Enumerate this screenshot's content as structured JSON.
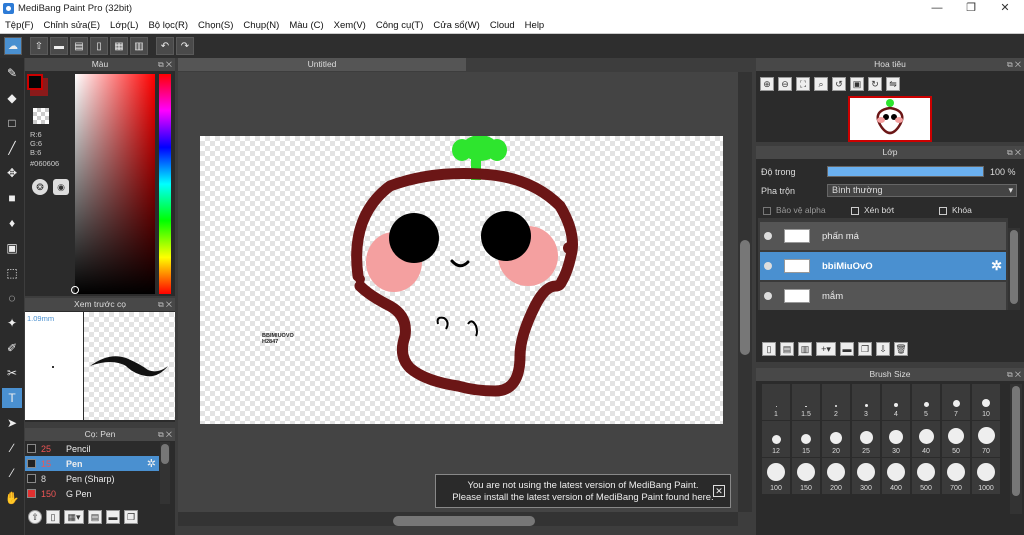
{
  "window": {
    "title": "MediBang Paint Pro (32bit)"
  },
  "menu": [
    "Tệp(F)",
    "Chỉnh sửa(E)",
    "Lớp(L)",
    "Bộ lọc(R)",
    "Chọn(S)",
    "Chụp(N)",
    "Màu (C)",
    "Xem(V)",
    "Công cụ(T)",
    "Cửa sổ(W)",
    "Cloud",
    "Help"
  ],
  "color_panel": {
    "title": "Màu",
    "r": "R:6",
    "g": "G:6",
    "b": "B:6",
    "hex": "#060606",
    "fg": "#060606",
    "bg": "#8b1a1a"
  },
  "preview_panel": {
    "title": "Xem trước cọ",
    "size": "1.09mm"
  },
  "brush_panel": {
    "title": "Cọ: Pen",
    "items": [
      {
        "size": "25",
        "name": "Pencil",
        "color": "#222222"
      },
      {
        "size": "15",
        "name": "Pen",
        "color": "#222222"
      },
      {
        "size": "8",
        "name": "Pen (Sharp)",
        "color": "#222222"
      },
      {
        "size": "150",
        "name": "G Pen",
        "color": "#e03030"
      }
    ]
  },
  "document": {
    "tab": "Untitled",
    "signature": "BBIMIUOVO",
    "signature2": "H2847"
  },
  "notice": {
    "line1": "You are not using the latest version of MediBang Paint.",
    "line2": "Please install the latest version of MediBang Paint found here.",
    "close": "✕"
  },
  "navigator": {
    "title": "Hoa tiêu"
  },
  "layer_panel": {
    "title": "Lớp",
    "opacity_label": "Độ trong",
    "opacity_value": "100 %",
    "opacity": 1.0,
    "blend_label": "Pha trộn",
    "blend_value": "Bình thường",
    "protect_alpha": "Bảo vệ alpha",
    "clipping": "Xén bớt",
    "lock": "Khóa",
    "layers": [
      {
        "name": "phấn má"
      },
      {
        "name": "bbiMiuOvO"
      },
      {
        "name": "mắm"
      }
    ]
  },
  "brush_size_panel": {
    "title": "Brush Size",
    "sizes": [
      "1",
      "1.5",
      "2",
      "3",
      "4",
      "5",
      "7",
      "10",
      "12",
      "15",
      "20",
      "25",
      "30",
      "40",
      "50",
      "70",
      "100",
      "150",
      "200",
      "300",
      "400",
      "500",
      "700",
      "1000"
    ]
  },
  "colors": {
    "accent": "#4a90d0",
    "sprout": "#2ee52e",
    "outline": "#6b1616",
    "cheek": "#f4a0a0"
  }
}
